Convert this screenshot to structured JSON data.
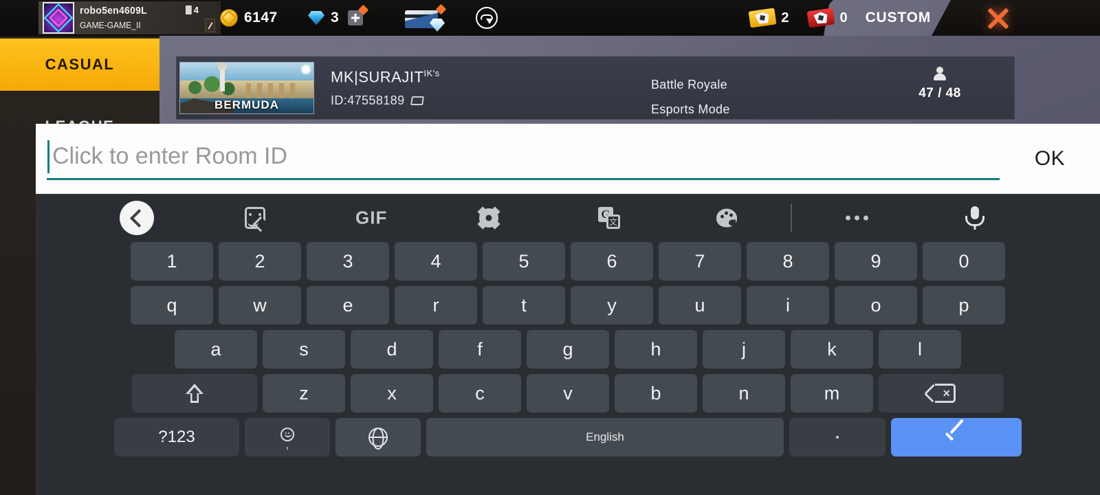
{
  "topbar": {
    "player_name": "robo5en4609L",
    "guild_name": "GAME-GAME_II",
    "level": "4",
    "coins": "6147",
    "gems": "3",
    "gold_tickets": "2",
    "red_tickets": "0",
    "custom_label": "CUSTOM",
    "icons": {
      "avatar": "avatar-frame",
      "level": "level-badge-icon",
      "edit": "pen-edit-icon",
      "coin": "gold-coin-icon",
      "gem": "blue-diamond-icon",
      "add_gem": "plus-button-icon",
      "store": "diamond-store-card-icon",
      "download": "cloud-download-icon",
      "gold_ticket": "gold-room-card-icon",
      "red_ticket": "red-room-card-icon",
      "close": "close-x-icon"
    }
  },
  "side_tabs": [
    {
      "label": "CASUAL",
      "active": true
    },
    {
      "label": "LEAGUE",
      "active": false
    }
  ],
  "room_card": {
    "map_name": "BERMUDA",
    "host_name": "MK|SURAJIT",
    "host_suffix": "IK's",
    "room_id": "ID:47558189",
    "mode_line1": "Battle Royale",
    "mode_line2": "Esports Mode",
    "player_count": "47 / 48"
  },
  "dialog": {
    "input_value": "",
    "input_placeholder": "Click to enter Room ID",
    "ok_label": "OK",
    "accent_color": "#0f7f78"
  },
  "keyboard": {
    "toolbar": [
      {
        "name": "back-icon",
        "label": ""
      },
      {
        "name": "sticker-icon",
        "label": ""
      },
      {
        "name": "gif-icon",
        "label": "GIF"
      },
      {
        "name": "gear-icon",
        "label": ""
      },
      {
        "name": "translate-icon",
        "label": "G"
      },
      {
        "name": "palette-icon",
        "label": ""
      },
      {
        "name": "more-options-icon",
        "label": ""
      },
      {
        "name": "microphone-icon",
        "label": ""
      }
    ],
    "row_numbers": [
      "1",
      "2",
      "3",
      "4",
      "5",
      "6",
      "7",
      "8",
      "9",
      "0"
    ],
    "row_top": [
      "q",
      "w",
      "e",
      "r",
      "t",
      "y",
      "u",
      "i",
      "o",
      "p"
    ],
    "row_home": [
      "a",
      "s",
      "d",
      "f",
      "g",
      "h",
      "j",
      "k",
      "l"
    ],
    "row_bottom": [
      "z",
      "x",
      "c",
      "v",
      "b",
      "n",
      "m"
    ],
    "symbols_label": "?123",
    "space_label": "English",
    "period_label": ".",
    "enter_label": "",
    "shift_label": "",
    "backspace_label": "",
    "enter_color": "#5a93f5",
    "key_color": "#434a50",
    "fn_key_color": "#383e44",
    "kb_background": "#2a2e33"
  }
}
